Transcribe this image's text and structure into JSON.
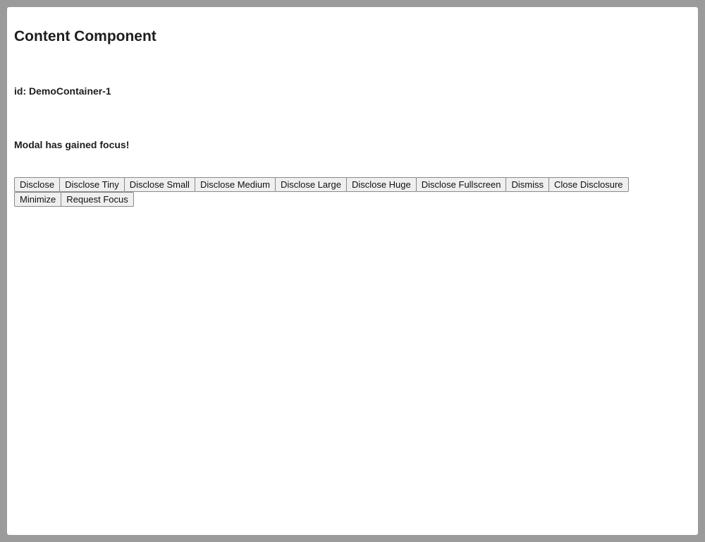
{
  "content": {
    "title": "Content Component",
    "container_id": "id: DemoContainer-1",
    "focus_status": "Modal has gained focus!"
  },
  "buttons": [
    {
      "label": "Disclose"
    },
    {
      "label": "Disclose Tiny"
    },
    {
      "label": "Disclose Small"
    },
    {
      "label": "Disclose Medium"
    },
    {
      "label": "Disclose Large"
    },
    {
      "label": "Disclose Huge"
    },
    {
      "label": "Disclose Fullscreen"
    },
    {
      "label": "Dismiss"
    },
    {
      "label": "Close Disclosure"
    },
    {
      "label": "Minimize"
    },
    {
      "label": "Request Focus"
    }
  ],
  "colors": {
    "backdrop": "#9b9b9b",
    "panel": "#ffffff",
    "button_background": "#efefef",
    "button_border": "#8a8a8a"
  }
}
